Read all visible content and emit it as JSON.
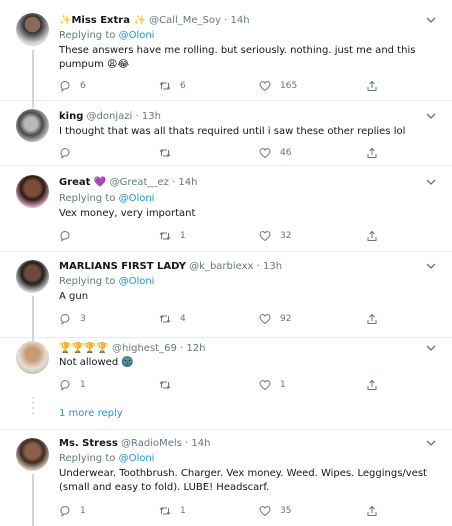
{
  "tweets": [
    {
      "name": "✨Miss Extra ✨",
      "handle": "@Call_Me_Soy",
      "time": "· 14h",
      "replying_prefix": "Replying to",
      "replying_to": "@Oloni",
      "text": "These answers have me rolling. but seriously. nothing. just me and this pumpum 😩😂",
      "replies": "6",
      "retweets": "6",
      "likes": "165"
    },
    {
      "name": "king",
      "handle": "@donjazi",
      "time": "· 13h",
      "text": "I thought that was all thats required until  i saw these other replies lol",
      "replies": "",
      "retweets": "",
      "likes": "46"
    },
    {
      "name": "Great 💜",
      "handle": "@Great__ez",
      "time": "· 14h",
      "replying_prefix": "Replying to",
      "replying_to": "@Oloni",
      "text": "Vex money, very important",
      "replies": "",
      "retweets": "1",
      "likes": "32"
    },
    {
      "name": "MARLIANS FIRST LADY",
      "handle": "@k_barbiexx",
      "time": "· 13h",
      "replying_prefix": "Replying to",
      "replying_to": "@Oloni",
      "text": "A gun",
      "replies": "3",
      "retweets": "4",
      "likes": "92"
    },
    {
      "name": "🏆🏆🏆🏆",
      "handle": "@highest_69",
      "time": "· 12h",
      "text": "Not allowed 🌚",
      "replies": "1",
      "retweets": "",
      "likes": "1"
    },
    {
      "name": "Ms. Stress",
      "handle": "@RadioMels",
      "time": "· 14h",
      "replying_prefix": "Replying to",
      "replying_to": "@Oloni",
      "text_line1": "Underwear. Toothbrush. Charger. Vex money. Weed. Wipes. Leggings/vest",
      "text_line2": "(small and easy to fold). LUBE!  Headscarf.",
      "replies": "1",
      "retweets": "1",
      "likes": "35"
    }
  ],
  "more_reply": "1 more reply",
  "colors": {
    "link": "#1b95e0",
    "muted": "#657786",
    "thread_line": "#ccd6dd",
    "divider": "#e6ecf0"
  }
}
